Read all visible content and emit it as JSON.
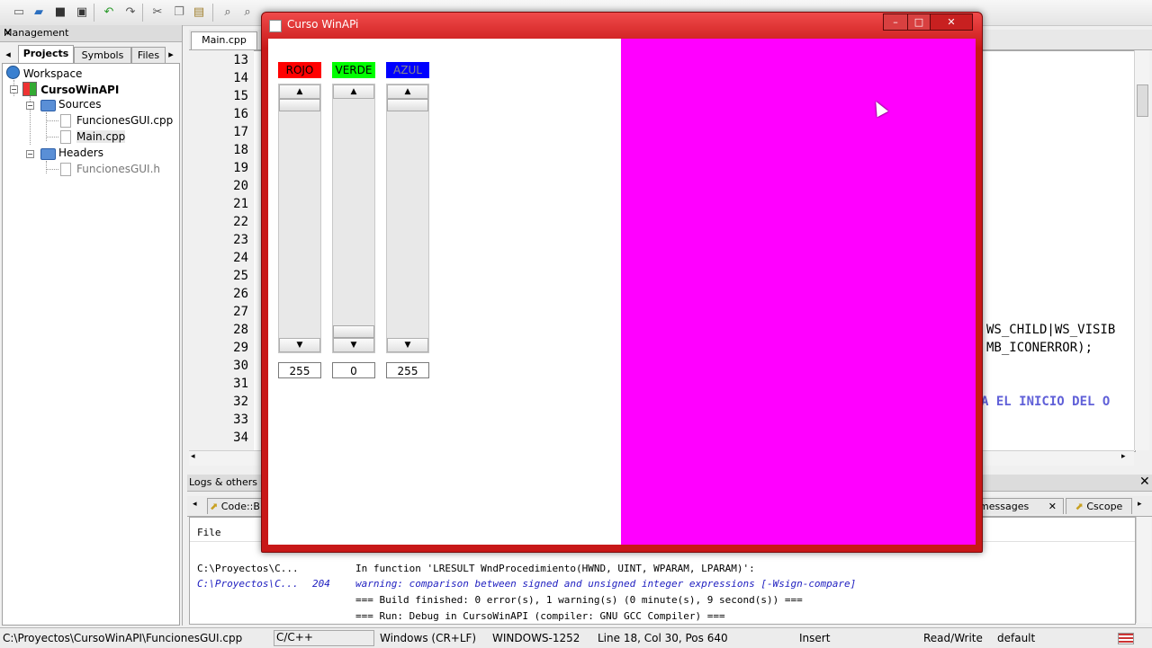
{
  "ide": {
    "management_title": "Management",
    "mgmt_tabs": [
      "Projects",
      "Symbols",
      "Files"
    ],
    "tree": {
      "workspace": "Workspace",
      "project": "CursoWinAPI",
      "sources": "Sources",
      "source_files": [
        "FuncionesGUI.cpp",
        "Main.cpp"
      ],
      "headers": "Headers",
      "header_files": [
        "FuncionesGUI.h"
      ]
    },
    "editor_tab": "Main.cpp",
    "line_numbers": [
      "13",
      "14",
      "15",
      "16",
      "17",
      "18",
      "19",
      "20",
      "21",
      "22",
      "23",
      "24",
      "25",
      "26",
      "27",
      "28",
      "29",
      "30",
      "31",
      "32",
      "33",
      "34"
    ],
    "code_fragments": [
      "WS_CHILD|WS_VISIB",
      "MB_ICONERROR);",
      "A EL INICIO DEL O"
    ],
    "logs_title": "Logs & others",
    "logs_tabs": [
      "Code::B",
      "messages",
      "Cscope"
    ],
    "log_header": "File",
    "log_lines": [
      {
        "file": "C:\\Proyectos\\C...",
        "line": "",
        "msg": "In function 'LRESULT WndProcedimiento(HWND, UINT, WPARAM, LPARAM)':"
      },
      {
        "file": "C:\\Proyectos\\C...",
        "line": "204",
        "msg": "warning: comparison between signed and unsigned integer expressions [-Wsign-compare]"
      },
      {
        "file": "",
        "line": "",
        "msg": "=== Build finished: 0 error(s), 1 warning(s) (0 minute(s), 9 second(s)) ==="
      },
      {
        "file": "",
        "line": "",
        "msg": "=== Run: Debug in CursoWinAPI (compiler: GNU GCC Compiler) ==="
      }
    ],
    "status": {
      "path": "C:\\Proyectos\\CursoWinAPI\\FuncionesGUI.cpp",
      "language": "C/C++",
      "eol": "Windows (CR+LF)",
      "encoding": "WINDOWS-1252",
      "position": "Line 18, Col 30, Pos 640",
      "mode": "Insert",
      "access": "Read/Write",
      "profile": "default"
    }
  },
  "app_window": {
    "title": "Curso WinAPi",
    "controls": {
      "minimize": "–",
      "maximize": "□",
      "close": "✕"
    },
    "sliders": [
      {
        "label": "ROJO",
        "value": "255",
        "level": 1.0,
        "color": "#ff0000"
      },
      {
        "label": "VERDE",
        "value": "0",
        "level": 0.0,
        "color": "#00ff00"
      },
      {
        "label": "AZUL",
        "value": "255",
        "level": 1.0,
        "color": "#0000ff"
      }
    ],
    "preview_color": "#ff00ff"
  },
  "colors": {
    "window_frame": "#c81818",
    "code_keyword": "#0000c8"
  }
}
